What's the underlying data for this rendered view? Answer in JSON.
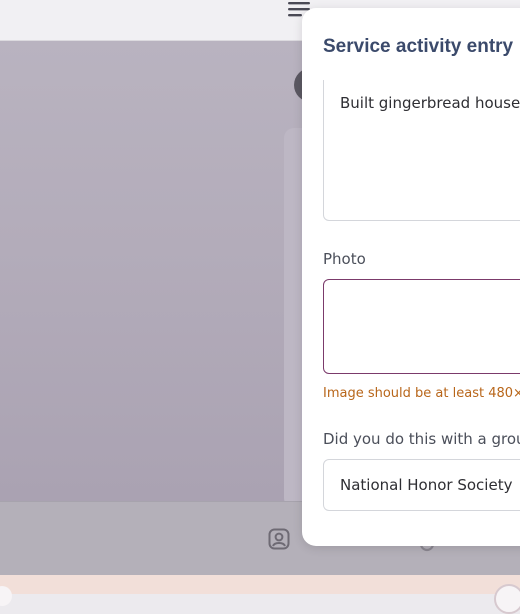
{
  "modal": {
    "title": "Service activity entry",
    "description_value": "Built gingerbread house",
    "photo_label": "Photo",
    "photo_hint": "Image should be at least 480×",
    "group_label": "Did you do this with a grou",
    "group_value": "National Honor Society"
  },
  "icons": {
    "menu": "hamburger-menu-icon",
    "profile": "profile-icon",
    "settings": "gear-icon"
  },
  "colors": {
    "title": "#3b4a6b",
    "photo_border": "#7b3a6b",
    "hint": "#b8661a"
  }
}
